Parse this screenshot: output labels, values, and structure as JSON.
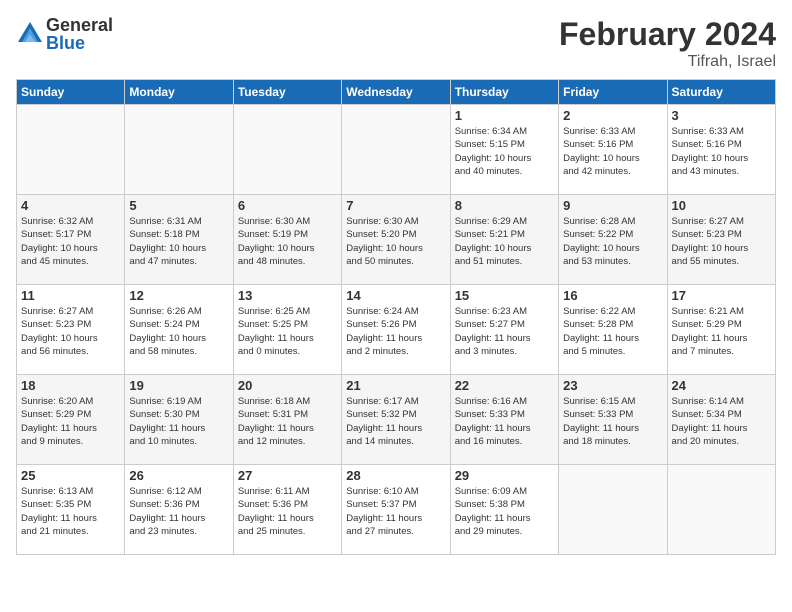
{
  "logo": {
    "general": "General",
    "blue": "Blue"
  },
  "title": {
    "month": "February 2024",
    "location": "Tifrah, Israel"
  },
  "weekdays": [
    "Sunday",
    "Monday",
    "Tuesday",
    "Wednesday",
    "Thursday",
    "Friday",
    "Saturday"
  ],
  "weeks": [
    [
      {
        "day": "",
        "info": ""
      },
      {
        "day": "",
        "info": ""
      },
      {
        "day": "",
        "info": ""
      },
      {
        "day": "",
        "info": ""
      },
      {
        "day": "1",
        "info": "Sunrise: 6:34 AM\nSunset: 5:15 PM\nDaylight: 10 hours\nand 40 minutes."
      },
      {
        "day": "2",
        "info": "Sunrise: 6:33 AM\nSunset: 5:16 PM\nDaylight: 10 hours\nand 42 minutes."
      },
      {
        "day": "3",
        "info": "Sunrise: 6:33 AM\nSunset: 5:16 PM\nDaylight: 10 hours\nand 43 minutes."
      }
    ],
    [
      {
        "day": "4",
        "info": "Sunrise: 6:32 AM\nSunset: 5:17 PM\nDaylight: 10 hours\nand 45 minutes."
      },
      {
        "day": "5",
        "info": "Sunrise: 6:31 AM\nSunset: 5:18 PM\nDaylight: 10 hours\nand 47 minutes."
      },
      {
        "day": "6",
        "info": "Sunrise: 6:30 AM\nSunset: 5:19 PM\nDaylight: 10 hours\nand 48 minutes."
      },
      {
        "day": "7",
        "info": "Sunrise: 6:30 AM\nSunset: 5:20 PM\nDaylight: 10 hours\nand 50 minutes."
      },
      {
        "day": "8",
        "info": "Sunrise: 6:29 AM\nSunset: 5:21 PM\nDaylight: 10 hours\nand 51 minutes."
      },
      {
        "day": "9",
        "info": "Sunrise: 6:28 AM\nSunset: 5:22 PM\nDaylight: 10 hours\nand 53 minutes."
      },
      {
        "day": "10",
        "info": "Sunrise: 6:27 AM\nSunset: 5:23 PM\nDaylight: 10 hours\nand 55 minutes."
      }
    ],
    [
      {
        "day": "11",
        "info": "Sunrise: 6:27 AM\nSunset: 5:23 PM\nDaylight: 10 hours\nand 56 minutes."
      },
      {
        "day": "12",
        "info": "Sunrise: 6:26 AM\nSunset: 5:24 PM\nDaylight: 10 hours\nand 58 minutes."
      },
      {
        "day": "13",
        "info": "Sunrise: 6:25 AM\nSunset: 5:25 PM\nDaylight: 11 hours\nand 0 minutes."
      },
      {
        "day": "14",
        "info": "Sunrise: 6:24 AM\nSunset: 5:26 PM\nDaylight: 11 hours\nand 2 minutes."
      },
      {
        "day": "15",
        "info": "Sunrise: 6:23 AM\nSunset: 5:27 PM\nDaylight: 11 hours\nand 3 minutes."
      },
      {
        "day": "16",
        "info": "Sunrise: 6:22 AM\nSunset: 5:28 PM\nDaylight: 11 hours\nand 5 minutes."
      },
      {
        "day": "17",
        "info": "Sunrise: 6:21 AM\nSunset: 5:29 PM\nDaylight: 11 hours\nand 7 minutes."
      }
    ],
    [
      {
        "day": "18",
        "info": "Sunrise: 6:20 AM\nSunset: 5:29 PM\nDaylight: 11 hours\nand 9 minutes."
      },
      {
        "day": "19",
        "info": "Sunrise: 6:19 AM\nSunset: 5:30 PM\nDaylight: 11 hours\nand 10 minutes."
      },
      {
        "day": "20",
        "info": "Sunrise: 6:18 AM\nSunset: 5:31 PM\nDaylight: 11 hours\nand 12 minutes."
      },
      {
        "day": "21",
        "info": "Sunrise: 6:17 AM\nSunset: 5:32 PM\nDaylight: 11 hours\nand 14 minutes."
      },
      {
        "day": "22",
        "info": "Sunrise: 6:16 AM\nSunset: 5:33 PM\nDaylight: 11 hours\nand 16 minutes."
      },
      {
        "day": "23",
        "info": "Sunrise: 6:15 AM\nSunset: 5:33 PM\nDaylight: 11 hours\nand 18 minutes."
      },
      {
        "day": "24",
        "info": "Sunrise: 6:14 AM\nSunset: 5:34 PM\nDaylight: 11 hours\nand 20 minutes."
      }
    ],
    [
      {
        "day": "25",
        "info": "Sunrise: 6:13 AM\nSunset: 5:35 PM\nDaylight: 11 hours\nand 21 minutes."
      },
      {
        "day": "26",
        "info": "Sunrise: 6:12 AM\nSunset: 5:36 PM\nDaylight: 11 hours\nand 23 minutes."
      },
      {
        "day": "27",
        "info": "Sunrise: 6:11 AM\nSunset: 5:36 PM\nDaylight: 11 hours\nand 25 minutes."
      },
      {
        "day": "28",
        "info": "Sunrise: 6:10 AM\nSunset: 5:37 PM\nDaylight: 11 hours\nand 27 minutes."
      },
      {
        "day": "29",
        "info": "Sunrise: 6:09 AM\nSunset: 5:38 PM\nDaylight: 11 hours\nand 29 minutes."
      },
      {
        "day": "",
        "info": ""
      },
      {
        "day": "",
        "info": ""
      }
    ]
  ]
}
